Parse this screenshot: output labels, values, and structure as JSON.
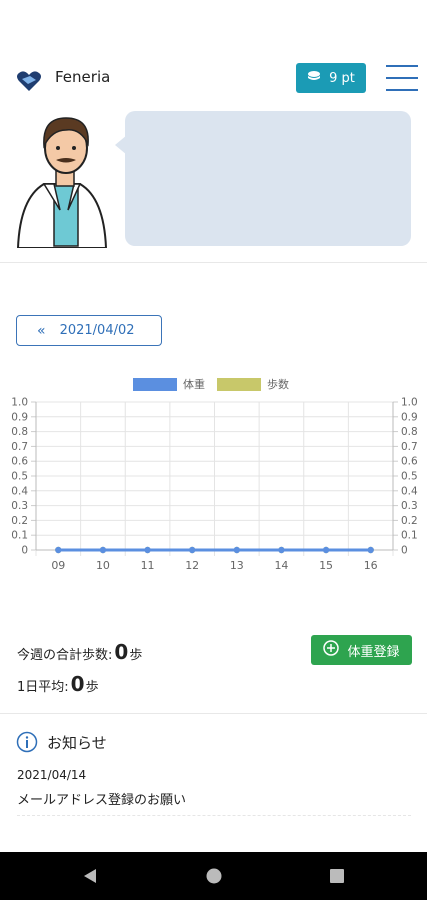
{
  "header": {
    "app_name": "Feneria",
    "points": "9 pt"
  },
  "date_nav": {
    "date": "2021/04/02"
  },
  "chart_data": {
    "type": "line",
    "legend": [
      {
        "name": "体重",
        "color": "#5b8fe0"
      },
      {
        "name": "歩数",
        "color": "#c8c86a"
      }
    ],
    "categories": [
      "09",
      "10",
      "11",
      "12",
      "13",
      "14",
      "15",
      "16"
    ],
    "series": [
      {
        "name": "体重",
        "values": [
          0,
          0,
          0,
          0,
          0,
          0,
          0,
          0
        ],
        "color": "#5b8fe0"
      },
      {
        "name": "歩数",
        "values": [
          0,
          0,
          0,
          0,
          0,
          0,
          0,
          0
        ],
        "color": "#c8c86a"
      }
    ],
    "ylim": [
      0,
      1.0
    ],
    "yticks": [
      "1.0",
      "0.9",
      "0.8",
      "0.7",
      "0.6",
      "0.5",
      "0.4",
      "0.3",
      "0.2",
      "0.1",
      "0"
    ],
    "grid": true,
    "legend_position": "top"
  },
  "stats": {
    "weekly_steps_label": "今週の合計歩数:",
    "weekly_steps_value": "0",
    "daily_avg_label": "1日平均:",
    "daily_avg_value": "0",
    "unit": "歩"
  },
  "register_button": {
    "label": "体重登録"
  },
  "notice": {
    "title": "お知らせ",
    "date": "2021/04/14",
    "text": "メールアドレス登録のお願い"
  },
  "colors": {
    "accent": "#1b9bb5",
    "primary": "#2f6fb8",
    "success": "#2ea44f"
  }
}
